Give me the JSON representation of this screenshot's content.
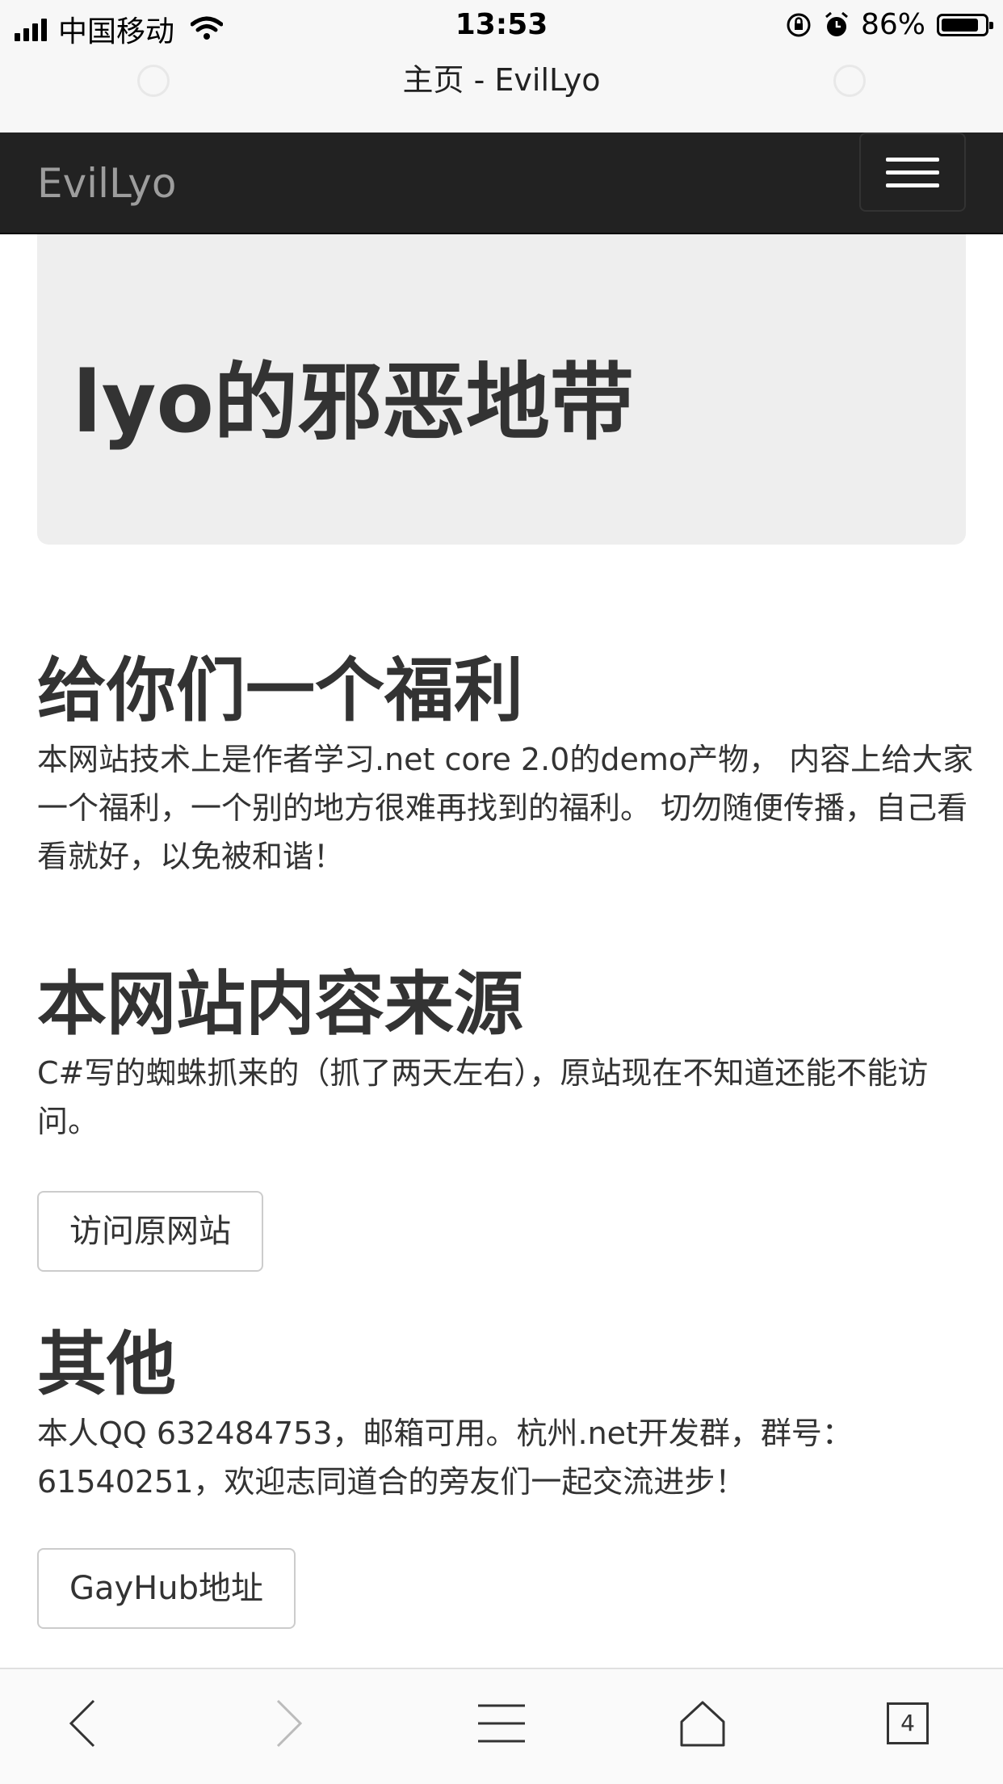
{
  "status_bar": {
    "carrier": "中国移动",
    "time": "13:53",
    "battery": "86%",
    "battery_level": 0.86
  },
  "browser": {
    "page_title": "主页 - EvilLyo",
    "tab_count": "4"
  },
  "navbar": {
    "brand": "EvilLyo",
    "toggle_icon": "hamburger-menu-icon"
  },
  "jumbotron": {
    "title": "lyo的邪恶地带"
  },
  "sections": {
    "welfare": {
      "heading": "给你们一个福利",
      "text": "本网站技术上是作者学习.net core 2.0的demo产物， 内容上给大家一个福利，一个别的地方很难再找到的福利。 切勿随便传播，自己看看就好，以免被和谐！"
    },
    "source": {
      "heading": "本网站内容来源",
      "text": "C#写的蜘蛛抓来的（抓了两天左右），原站现在不知道还能不能访问。",
      "button": "访问原网站"
    },
    "other": {
      "heading": "其他",
      "text": "本人QQ 632484753，邮箱可用。杭州.net开发群，群号：61540251，欢迎志同道合的旁友们一起交流进步！",
      "button": "GayHub地址"
    }
  },
  "colors": {
    "navbar_bg": "#222222",
    "brand_text": "#9d9d9d",
    "jumbotron_bg": "#eeeeee",
    "body_text": "#333333"
  }
}
